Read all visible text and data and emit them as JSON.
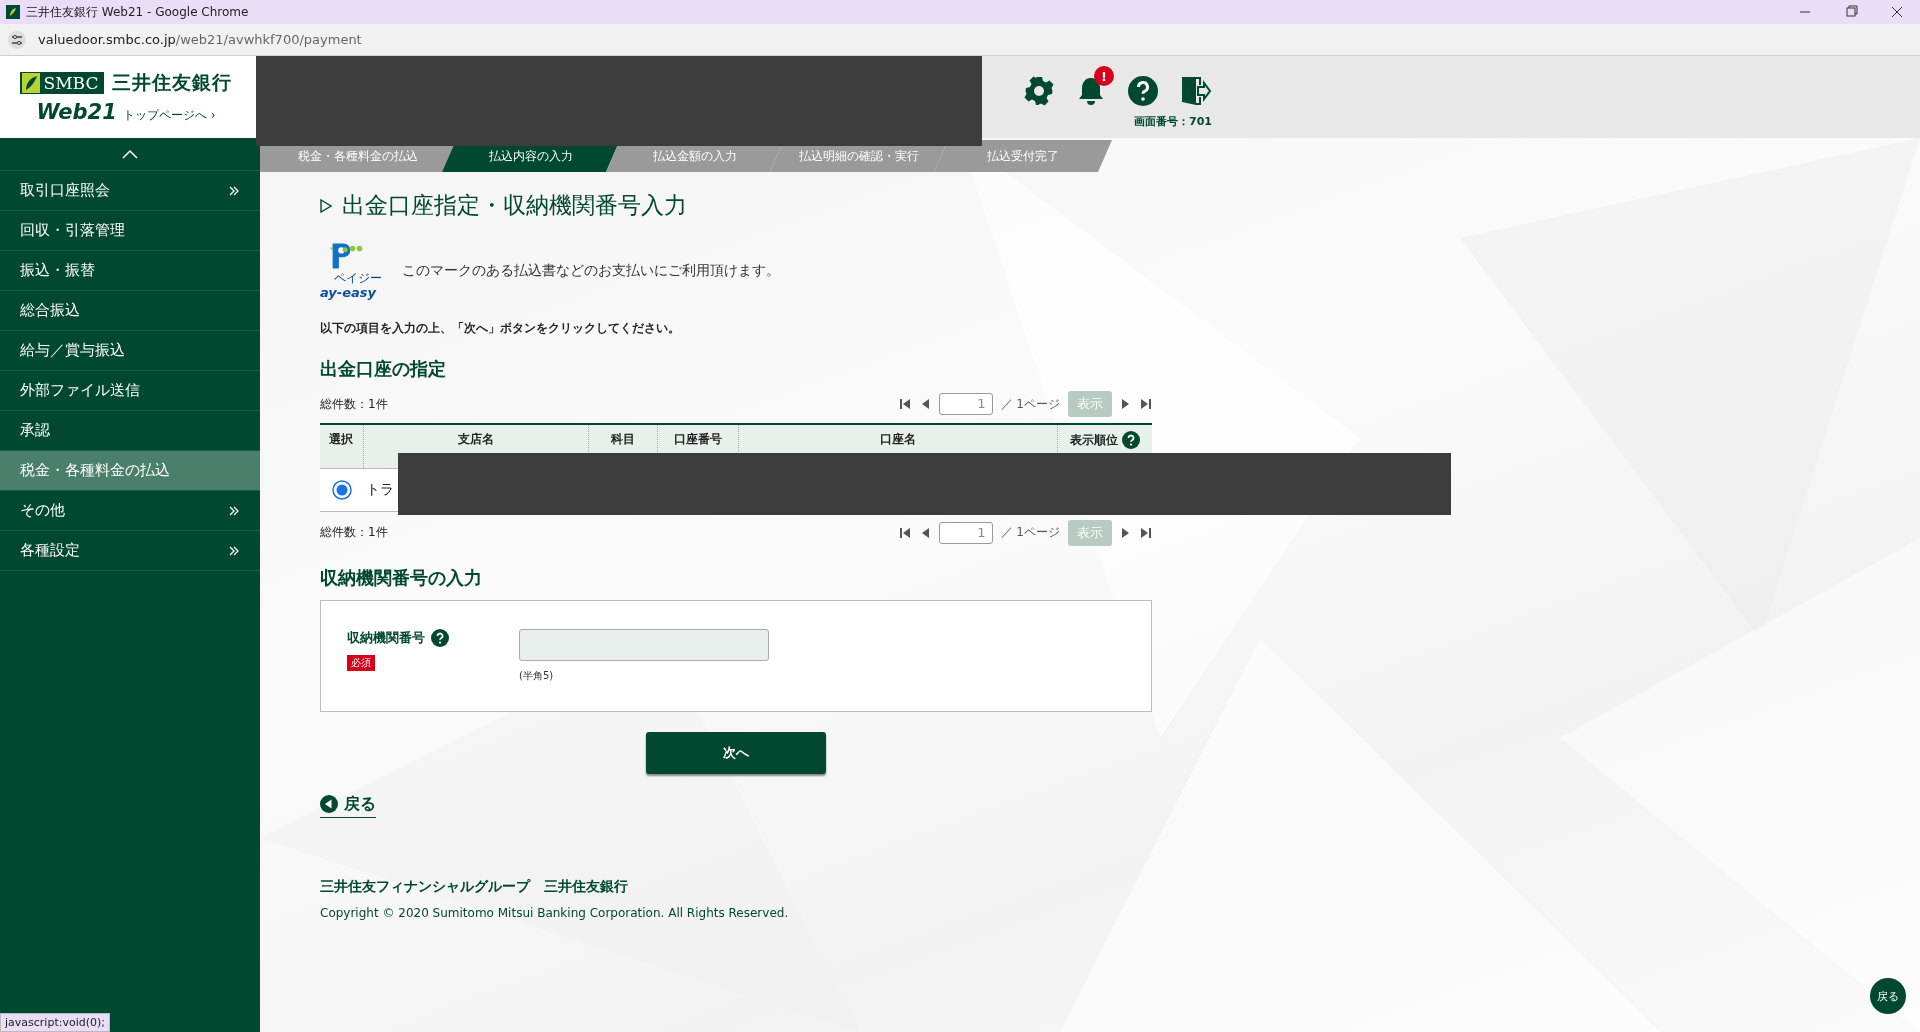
{
  "browser": {
    "title": "三井住友銀行 Web21 - Google Chrome",
    "url_host": "valuedoor.smbc.co.jp",
    "url_path": "/web21/avwhkf700/payment",
    "status_text": "javascript:void(0);"
  },
  "header": {
    "logo": {
      "mark": "SMBC",
      "bank": "三井住友銀行",
      "product": "Web21",
      "top_link": "トップページへ ›"
    },
    "notification_badge": "!",
    "screen_number": "画面番号：701"
  },
  "sidebar": {
    "items": [
      {
        "label": "取引口座照会",
        "expandable": true,
        "selected": false
      },
      {
        "label": "回収・引落管理",
        "expandable": false,
        "selected": false
      },
      {
        "label": "振込・振替",
        "expandable": false,
        "selected": false
      },
      {
        "label": "総合振込",
        "expandable": false,
        "selected": false
      },
      {
        "label": "給与／賞与振込",
        "expandable": false,
        "selected": false
      },
      {
        "label": "外部ファイル送信",
        "expandable": false,
        "selected": false
      },
      {
        "label": "承認",
        "expandable": false,
        "selected": false
      },
      {
        "label": "税金・各種料金の払込",
        "expandable": false,
        "selected": true
      },
      {
        "label": "その他",
        "expandable": true,
        "selected": false
      },
      {
        "label": "各種設定",
        "expandable": true,
        "selected": false
      }
    ]
  },
  "steps": [
    {
      "label": "税金・各種料金の払込",
      "selected": false
    },
    {
      "label": "払込内容の入力",
      "selected": true
    },
    {
      "label": "払込金額の入力",
      "selected": false
    },
    {
      "label": "払込明細の確認・実行",
      "selected": false
    },
    {
      "label": "払込受付完了",
      "selected": false
    }
  ],
  "page": {
    "title": "出金口座指定・収納機関番号入力",
    "payeasy_text": "ay-easy",
    "payeasy_kana": "ペイジー",
    "payeasy_note": "このマークのある払込書などのお支払いにご利用頂けます。",
    "instruction": "以下の項目を入力の上、「次へ」ボタンをクリックしてください。"
  },
  "account_section": {
    "heading": "出金口座の指定",
    "total_top": "総件数：1件",
    "pager_top": {
      "page": "1",
      "pages": "／ 1ページ",
      "button": "表示"
    },
    "columns": [
      {
        "label": "選択",
        "help": false
      },
      {
        "label": "支店名",
        "help": false
      },
      {
        "label": "科目",
        "help": false
      },
      {
        "label": "口座番号",
        "help": false
      },
      {
        "label": "口座名",
        "help": false
      },
      {
        "label": "表示順位",
        "help": true
      }
    ],
    "rows": [
      {
        "selected": true,
        "branch": "トラ"
      }
    ],
    "total_bottom": "総件数：1件",
    "pager_bottom": {
      "page": "1",
      "pages": "／ 1ページ",
      "button": "表示"
    }
  },
  "org_section": {
    "heading": "収納機関番号の入力",
    "field_label": "収納機関番号",
    "required": "必須",
    "hint": "(半角5)",
    "next_button": "次へ"
  },
  "back_link": "戻る",
  "footer": {
    "group": "三井住友フィナンシャルグループ　三井住友銀行",
    "copyright": "Copyright © 2020 Sumitomo Mitsui Banking Corporation. All Rights Reserved."
  },
  "float_back": "戻る"
}
